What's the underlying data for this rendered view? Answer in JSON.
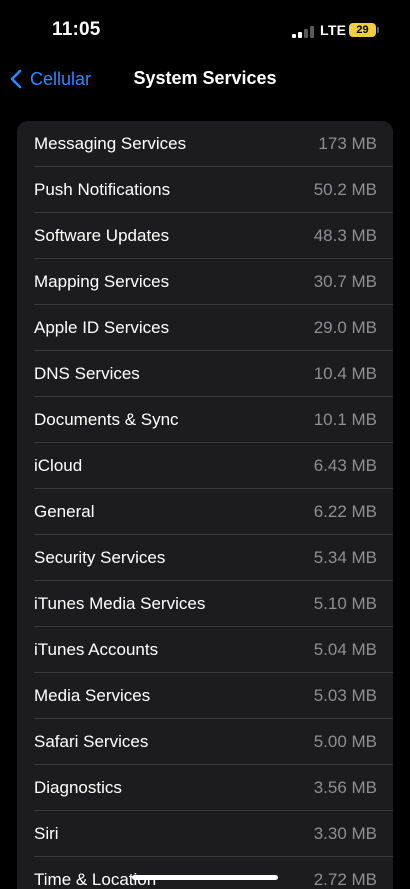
{
  "status_bar": {
    "time": "11:05",
    "network": "LTE",
    "battery_level": "29",
    "signal_bars_active": 2,
    "signal_bars_total": 4,
    "battery_color": "#f1cf3f"
  },
  "nav": {
    "back_label": "Cellular",
    "title": "System Services",
    "accent_color": "#2f88ff"
  },
  "services": [
    {
      "name": "Messaging Services",
      "usage": "173 MB"
    },
    {
      "name": "Push Notifications",
      "usage": "50.2 MB"
    },
    {
      "name": "Software Updates",
      "usage": "48.3 MB"
    },
    {
      "name": "Mapping Services",
      "usage": "30.7 MB"
    },
    {
      "name": "Apple ID Services",
      "usage": "29.0 MB"
    },
    {
      "name": "DNS Services",
      "usage": "10.4 MB"
    },
    {
      "name": "Documents & Sync",
      "usage": "10.1 MB"
    },
    {
      "name": "iCloud",
      "usage": "6.43 MB"
    },
    {
      "name": "General",
      "usage": "6.22 MB"
    },
    {
      "name": "Security Services",
      "usage": "5.34 MB"
    },
    {
      "name": "iTunes Media Services",
      "usage": "5.10 MB"
    },
    {
      "name": "iTunes Accounts",
      "usage": "5.04 MB"
    },
    {
      "name": "Media Services",
      "usage": "5.03 MB"
    },
    {
      "name": "Safari Services",
      "usage": "5.00 MB"
    },
    {
      "name": "Diagnostics",
      "usage": "3.56 MB"
    },
    {
      "name": "Siri",
      "usage": "3.30 MB"
    },
    {
      "name": "Time & Location",
      "usage": "2.72 MB"
    }
  ]
}
